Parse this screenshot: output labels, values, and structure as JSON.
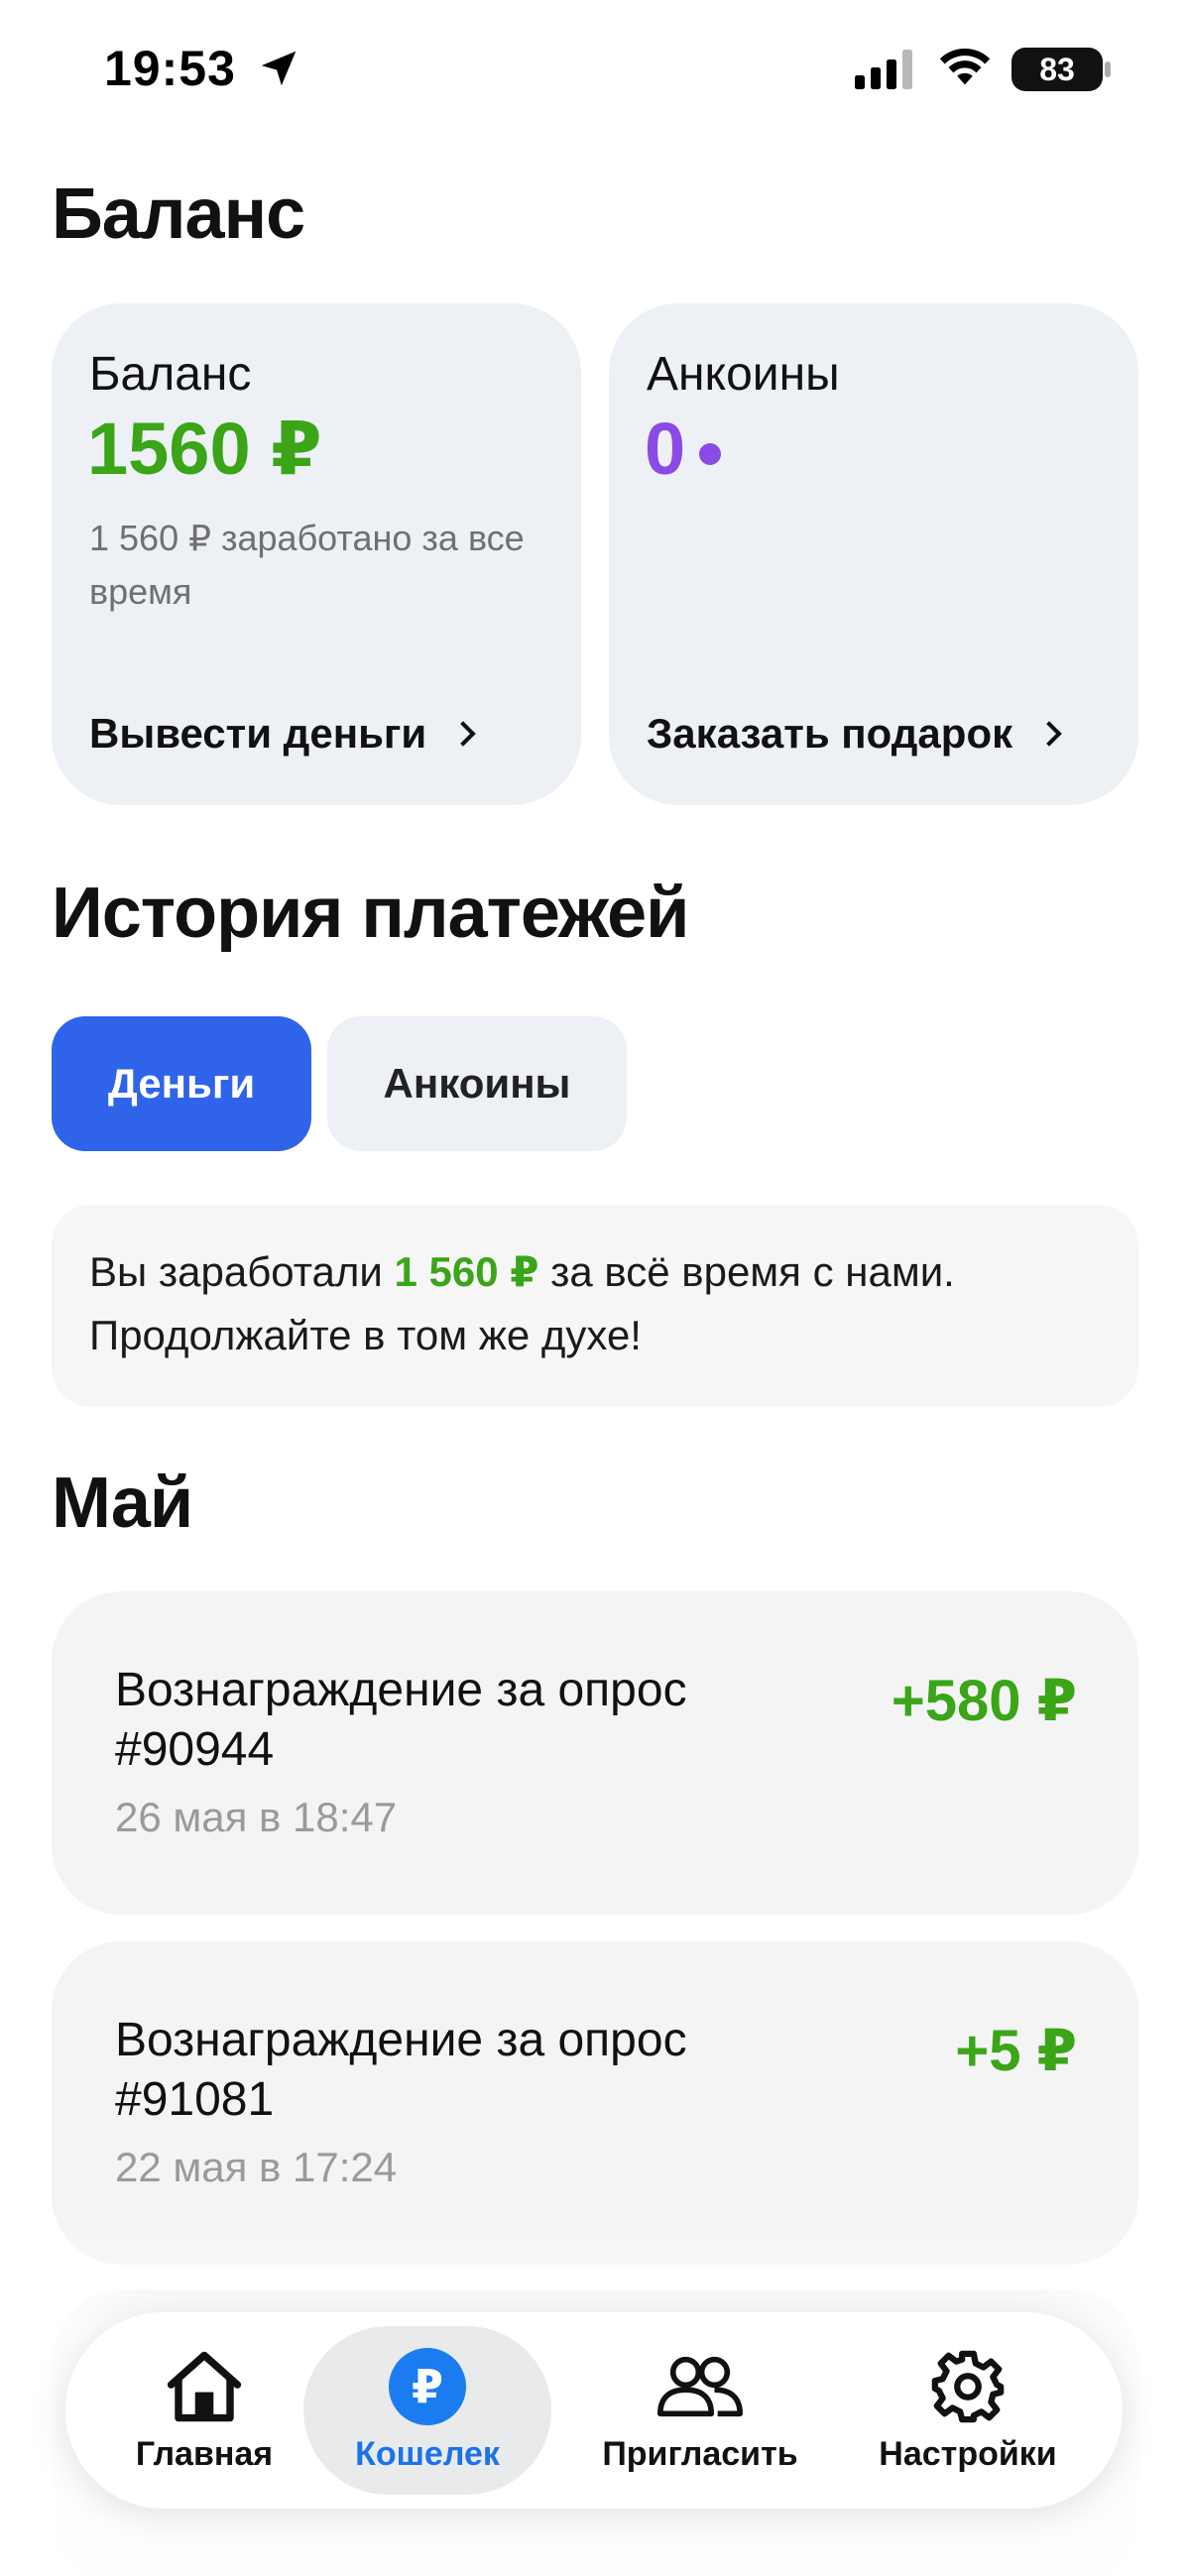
{
  "status_bar": {
    "time": "19:53",
    "battery": "83",
    "icons": [
      "location-arrow-icon",
      "cellular-signal-icon",
      "wifi-icon",
      "battery-icon"
    ]
  },
  "page": {
    "title": "Баланс"
  },
  "balance_card": {
    "title": "Баланс",
    "value": "1560 ₽",
    "subtitle": "1 560 ₽ заработано за все время",
    "action": "Вывести деньги"
  },
  "coins_card": {
    "title": "Анкоины",
    "value": "0",
    "action": "Заказать подарок"
  },
  "history": {
    "title": "История платежей",
    "tabs": [
      {
        "label": "Деньги",
        "active": true
      },
      {
        "label": "Анкоины",
        "active": false
      }
    ],
    "banner": {
      "text_before": "Вы заработали ",
      "amount": "1 560 ₽",
      "text_after": " за всё время с нами. Продолжайте в том же духе!"
    },
    "month": "Май",
    "transactions": [
      {
        "title": "Вознаграждение за опрос #90944",
        "date": "26 мая в 18:47",
        "amount": "+580 ₽"
      },
      {
        "title": "Вознаграждение за опрос #91081",
        "date": "22 мая в 17:24",
        "amount": "+5 ₽"
      }
    ]
  },
  "nav": {
    "items": [
      {
        "label": "Главная",
        "icon": "home-icon",
        "active": false
      },
      {
        "label": "Кошелек",
        "icon": "ruble-wallet-icon",
        "active": true
      },
      {
        "label": "Пригласить",
        "icon": "people-icon",
        "active": false
      },
      {
        "label": "Настройки",
        "icon": "gear-icon",
        "active": false
      }
    ],
    "active_color": "#1a73e8"
  },
  "colors": {
    "accent_green": "#3aa517",
    "accent_blue": "#2f63ea",
    "coin_purple": "#8a4ae3"
  }
}
